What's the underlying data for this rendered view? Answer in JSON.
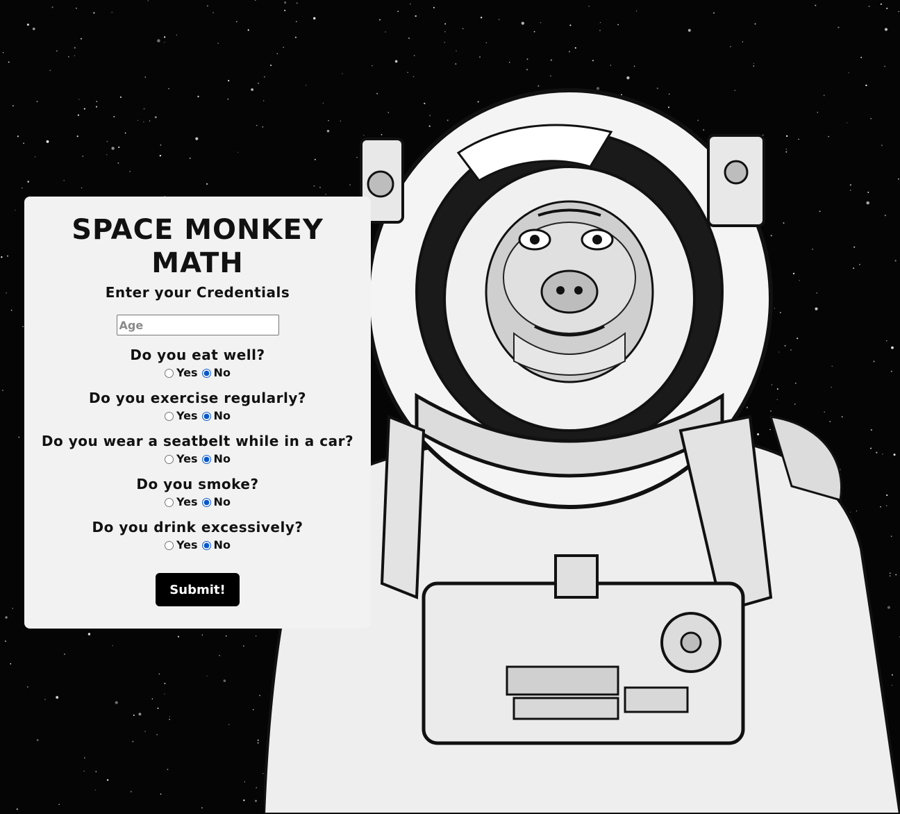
{
  "form": {
    "title_line1": "SPACE MONKEY",
    "title_line2": "MATH",
    "subtitle": "Enter your Credentials",
    "age_placeholder": "Age",
    "age_value": "",
    "questions": [
      {
        "text": "Do you eat well?",
        "yes_label": "Yes",
        "no_label": "No",
        "selected": "No"
      },
      {
        "text": "Do you exercise regularly?",
        "yes_label": "Yes",
        "no_label": "No",
        "selected": "No"
      },
      {
        "text": "Do you wear a seatbelt while in a car?",
        "yes_label": "Yes",
        "no_label": "No",
        "selected": "No"
      },
      {
        "text": "Do you smoke?",
        "yes_label": "Yes",
        "no_label": "No",
        "selected": "No"
      },
      {
        "text": "Do you drink excessively?",
        "yes_label": "Yes",
        "no_label": "No",
        "selected": "No"
      }
    ],
    "submit_label": "Submit!"
  },
  "background": {
    "icon": "starfield-icon",
    "illustration_icon": "astronaut-monkey-icon"
  },
  "colors": {
    "panel_bg": "#f2f2f2",
    "page_bg": "#050505",
    "button_bg": "#000000",
    "radio_accent": "#0a58ca"
  }
}
